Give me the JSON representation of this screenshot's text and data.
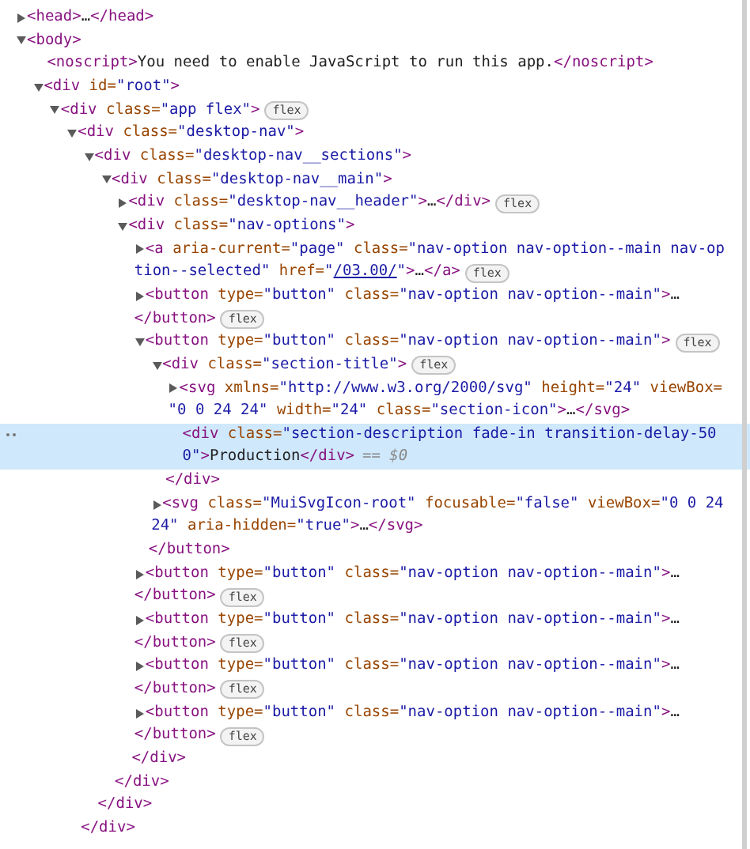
{
  "tree": [
    {
      "kind": "collapsed",
      "selected": false,
      "lines": [
        [
          {
            "kind": "tag",
            "text": "<head>"
          },
          {
            "kind": "text",
            "text": "…"
          },
          {
            "kind": "tag",
            "text": "</head>"
          }
        ]
      ]
    },
    {
      "kind": "expanded",
      "selected": false,
      "lines": [
        [
          {
            "kind": "tag",
            "text": "<body>"
          }
        ]
      ],
      "children": [
        {
          "kind": "leaf",
          "selected": false,
          "lines": [
            [
              {
                "kind": "tag",
                "text": "<noscript>"
              },
              {
                "kind": "text",
                "text": "You need to enable JavaScript to run this app."
              },
              {
                "kind": "tag",
                "text": "</noscript>"
              }
            ]
          ]
        },
        {
          "kind": "expanded",
          "selected": false,
          "lines": [
            [
              {
                "kind": "tag",
                "text": "<div"
              },
              {
                "kind": "attr",
                "text": " id="
              },
              {
                "kind": "value",
                "text": "\"root\""
              },
              {
                "kind": "tag",
                "text": ">"
              }
            ]
          ],
          "children": [
            {
              "kind": "expanded",
              "selected": false,
              "badge": "flex",
              "lines": [
                [
                  {
                    "kind": "tag",
                    "text": "<div"
                  },
                  {
                    "kind": "attr",
                    "text": " class="
                  },
                  {
                    "kind": "value",
                    "text": "\"app flex\""
                  },
                  {
                    "kind": "tag",
                    "text": ">"
                  }
                ]
              ],
              "children": [
                {
                  "kind": "expanded",
                  "selected": false,
                  "lines": [
                    [
                      {
                        "kind": "tag",
                        "text": "<div"
                      },
                      {
                        "kind": "attr",
                        "text": " class="
                      },
                      {
                        "kind": "value",
                        "text": "\"desktop-nav\""
                      },
                      {
                        "kind": "tag",
                        "text": ">"
                      }
                    ]
                  ],
                  "close": [
                    {
                      "kind": "tag",
                      "text": "</div>"
                    }
                  ],
                  "children": [
                    {
                      "kind": "expanded",
                      "selected": false,
                      "lines": [
                        [
                          {
                            "kind": "tag",
                            "text": "<div"
                          },
                          {
                            "kind": "attr",
                            "text": " class="
                          },
                          {
                            "kind": "value",
                            "text": "\"desktop-nav__sections\""
                          },
                          {
                            "kind": "tag",
                            "text": ">"
                          }
                        ]
                      ],
                      "close": [
                        {
                          "kind": "tag",
                          "text": "</div>"
                        }
                      ],
                      "children": [
                        {
                          "kind": "expanded",
                          "selected": false,
                          "lines": [
                            [
                              {
                                "kind": "tag",
                                "text": "<div"
                              },
                              {
                                "kind": "attr",
                                "text": " class="
                              },
                              {
                                "kind": "value",
                                "text": "\"desktop-nav__main\""
                              },
                              {
                                "kind": "tag",
                                "text": ">"
                              }
                            ]
                          ],
                          "close": [
                            {
                              "kind": "tag",
                              "text": "</div>"
                            }
                          ],
                          "children": [
                            {
                              "kind": "collapsed",
                              "selected": false,
                              "badge": "flex",
                              "lines": [
                                [
                                  {
                                    "kind": "tag",
                                    "text": "<div"
                                  },
                                  {
                                    "kind": "attr",
                                    "text": " class="
                                  },
                                  {
                                    "kind": "value",
                                    "text": "\"desktop-nav__header\""
                                  },
                                  {
                                    "kind": "tag",
                                    "text": ">"
                                  },
                                  {
                                    "kind": "text",
                                    "text": "…"
                                  },
                                  {
                                    "kind": "tag",
                                    "text": "</div>"
                                  }
                                ]
                              ]
                            },
                            {
                              "kind": "expanded",
                              "selected": false,
                              "lines": [
                                [
                                  {
                                    "kind": "tag",
                                    "text": "<div"
                                  },
                                  {
                                    "kind": "attr",
                                    "text": " class="
                                  },
                                  {
                                    "kind": "value",
                                    "text": "\"nav-options\""
                                  },
                                  {
                                    "kind": "tag",
                                    "text": ">"
                                  }
                                ]
                              ],
                              "close": [
                                {
                                  "kind": "tag",
                                  "text": "</div>"
                                }
                              ],
                              "children": [
                                {
                                  "kind": "collapsed",
                                  "selected": false,
                                  "badge": "flex",
                                  "lines": [
                                    [
                                      {
                                        "kind": "tag",
                                        "text": "<a"
                                      },
                                      {
                                        "kind": "attr",
                                        "text": " aria-current="
                                      },
                                      {
                                        "kind": "value",
                                        "text": "\"page\""
                                      },
                                      {
                                        "kind": "attr",
                                        "text": " class="
                                      },
                                      {
                                        "kind": "value",
                                        "text": "\"nav-option nav-option--main nav-op"
                                      }
                                    ],
                                    [
                                      {
                                        "kind": "value",
                                        "text": "tion--selected\""
                                      },
                                      {
                                        "kind": "attr",
                                        "text": " href="
                                      },
                                      {
                                        "kind": "value",
                                        "text": "\""
                                      },
                                      {
                                        "kind": "link",
                                        "text": "/03.00/"
                                      },
                                      {
                                        "kind": "value",
                                        "text": "\""
                                      },
                                      {
                                        "kind": "tag",
                                        "text": ">"
                                      },
                                      {
                                        "kind": "text",
                                        "text": "…"
                                      },
                                      {
                                        "kind": "tag",
                                        "text": "</a>"
                                      }
                                    ]
                                  ]
                                },
                                {
                                  "kind": "collapsed",
                                  "selected": false,
                                  "badge": "flex",
                                  "lines": [
                                    [
                                      {
                                        "kind": "tag",
                                        "text": "<button"
                                      },
                                      {
                                        "kind": "attr",
                                        "text": " type="
                                      },
                                      {
                                        "kind": "value",
                                        "text": "\"button\""
                                      },
                                      {
                                        "kind": "attr",
                                        "text": " class="
                                      },
                                      {
                                        "kind": "value",
                                        "text": "\"nav-option nav-option--main\""
                                      },
                                      {
                                        "kind": "tag",
                                        "text": ">"
                                      },
                                      {
                                        "kind": "text",
                                        "text": "…"
                                      }
                                    ],
                                    [
                                      {
                                        "kind": "tag",
                                        "text": "</button>"
                                      }
                                    ]
                                  ]
                                },
                                {
                                  "kind": "expanded",
                                  "selected": false,
                                  "badge": "flex",
                                  "lines": [
                                    [
                                      {
                                        "kind": "tag",
                                        "text": "<button"
                                      },
                                      {
                                        "kind": "attr",
                                        "text": " type="
                                      },
                                      {
                                        "kind": "value",
                                        "text": "\"button\""
                                      },
                                      {
                                        "kind": "attr",
                                        "text": " class="
                                      },
                                      {
                                        "kind": "value",
                                        "text": "\"nav-option nav-option--main\""
                                      },
                                      {
                                        "kind": "tag",
                                        "text": ">"
                                      }
                                    ]
                                  ],
                                  "close": [
                                    {
                                      "kind": "tag",
                                      "text": "</button>"
                                    }
                                  ],
                                  "children": [
                                    {
                                      "kind": "expanded",
                                      "selected": false,
                                      "badge": "flex",
                                      "lines": [
                                        [
                                          {
                                            "kind": "tag",
                                            "text": "<div"
                                          },
                                          {
                                            "kind": "attr",
                                            "text": " class="
                                          },
                                          {
                                            "kind": "value",
                                            "text": "\"section-title\""
                                          },
                                          {
                                            "kind": "tag",
                                            "text": ">"
                                          }
                                        ]
                                      ],
                                      "close": [
                                        {
                                          "kind": "tag",
                                          "text": "</div>"
                                        }
                                      ],
                                      "children": [
                                        {
                                          "kind": "collapsed",
                                          "selected": false,
                                          "lines": [
                                            [
                                              {
                                                "kind": "tag",
                                                "text": "<svg"
                                              },
                                              {
                                                "kind": "attr",
                                                "text": " xmlns="
                                              },
                                              {
                                                "kind": "value",
                                                "text": "\"http://www.w3.org/2000/svg\""
                                              },
                                              {
                                                "kind": "attr",
                                                "text": " height="
                                              },
                                              {
                                                "kind": "value",
                                                "text": "\"24\""
                                              },
                                              {
                                                "kind": "attr",
                                                "text": " viewBox="
                                              }
                                            ],
                                            [
                                              {
                                                "kind": "value",
                                                "text": "\"0 0 24 24\""
                                              },
                                              {
                                                "kind": "attr",
                                                "text": " width="
                                              },
                                              {
                                                "kind": "value",
                                                "text": "\"24\""
                                              },
                                              {
                                                "kind": "attr",
                                                "text": " class="
                                              },
                                              {
                                                "kind": "value",
                                                "text": "\"section-icon\""
                                              },
                                              {
                                                "kind": "tag",
                                                "text": ">"
                                              },
                                              {
                                                "kind": "text",
                                                "text": "…"
                                              },
                                              {
                                                "kind": "tag",
                                                "text": "</svg>"
                                              }
                                            ]
                                          ]
                                        },
                                        {
                                          "kind": "leaf",
                                          "selected": true,
                                          "suffix": "== $0",
                                          "lines": [
                                            [
                                              {
                                                "kind": "tag",
                                                "text": "<div"
                                              },
                                              {
                                                "kind": "attr",
                                                "text": " class="
                                              },
                                              {
                                                "kind": "value",
                                                "text": "\"section-description fade-in transition-delay-50"
                                              }
                                            ],
                                            [
                                              {
                                                "kind": "value",
                                                "text": "0\""
                                              },
                                              {
                                                "kind": "tag",
                                                "text": ">"
                                              },
                                              {
                                                "kind": "text",
                                                "text": "Production"
                                              },
                                              {
                                                "kind": "tag",
                                                "text": "</div>"
                                              }
                                            ]
                                          ]
                                        }
                                      ]
                                    },
                                    {
                                      "kind": "collapsed",
                                      "selected": false,
                                      "lines": [
                                        [
                                          {
                                            "kind": "tag",
                                            "text": "<svg"
                                          },
                                          {
                                            "kind": "attr",
                                            "text": " class="
                                          },
                                          {
                                            "kind": "value",
                                            "text": "\"MuiSvgIcon-root\""
                                          },
                                          {
                                            "kind": "attr",
                                            "text": " focusable="
                                          },
                                          {
                                            "kind": "value",
                                            "text": "\"false\""
                                          },
                                          {
                                            "kind": "attr",
                                            "text": " viewBox="
                                          },
                                          {
                                            "kind": "value",
                                            "text": "\"0 0 24"
                                          }
                                        ],
                                        [
                                          {
                                            "kind": "value",
                                            "text": "24\""
                                          },
                                          {
                                            "kind": "attr",
                                            "text": " aria-hidden="
                                          },
                                          {
                                            "kind": "value",
                                            "text": "\"true\""
                                          },
                                          {
                                            "kind": "tag",
                                            "text": ">"
                                          },
                                          {
                                            "kind": "text",
                                            "text": "…"
                                          },
                                          {
                                            "kind": "tag",
                                            "text": "</svg>"
                                          }
                                        ]
                                      ]
                                    }
                                  ]
                                },
                                {
                                  "kind": "collapsed",
                                  "selected": false,
                                  "badge": "flex",
                                  "lines": [
                                    [
                                      {
                                        "kind": "tag",
                                        "text": "<button"
                                      },
                                      {
                                        "kind": "attr",
                                        "text": " type="
                                      },
                                      {
                                        "kind": "value",
                                        "text": "\"button\""
                                      },
                                      {
                                        "kind": "attr",
                                        "text": " class="
                                      },
                                      {
                                        "kind": "value",
                                        "text": "\"nav-option nav-option--main\""
                                      },
                                      {
                                        "kind": "tag",
                                        "text": ">"
                                      },
                                      {
                                        "kind": "text",
                                        "text": "…"
                                      }
                                    ],
                                    [
                                      {
                                        "kind": "tag",
                                        "text": "</button>"
                                      }
                                    ]
                                  ]
                                },
                                {
                                  "kind": "collapsed",
                                  "selected": false,
                                  "badge": "flex",
                                  "lines": [
                                    [
                                      {
                                        "kind": "tag",
                                        "text": "<button"
                                      },
                                      {
                                        "kind": "attr",
                                        "text": " type="
                                      },
                                      {
                                        "kind": "value",
                                        "text": "\"button\""
                                      },
                                      {
                                        "kind": "attr",
                                        "text": " class="
                                      },
                                      {
                                        "kind": "value",
                                        "text": "\"nav-option nav-option--main\""
                                      },
                                      {
                                        "kind": "tag",
                                        "text": ">"
                                      },
                                      {
                                        "kind": "text",
                                        "text": "…"
                                      }
                                    ],
                                    [
                                      {
                                        "kind": "tag",
                                        "text": "</button>"
                                      }
                                    ]
                                  ]
                                },
                                {
                                  "kind": "collapsed",
                                  "selected": false,
                                  "badge": "flex",
                                  "lines": [
                                    [
                                      {
                                        "kind": "tag",
                                        "text": "<button"
                                      },
                                      {
                                        "kind": "attr",
                                        "text": " type="
                                      },
                                      {
                                        "kind": "value",
                                        "text": "\"button\""
                                      },
                                      {
                                        "kind": "attr",
                                        "text": " class="
                                      },
                                      {
                                        "kind": "value",
                                        "text": "\"nav-option nav-option--main\""
                                      },
                                      {
                                        "kind": "tag",
                                        "text": ">"
                                      },
                                      {
                                        "kind": "text",
                                        "text": "…"
                                      }
                                    ],
                                    [
                                      {
                                        "kind": "tag",
                                        "text": "</button>"
                                      }
                                    ]
                                  ]
                                },
                                {
                                  "kind": "collapsed",
                                  "selected": false,
                                  "badge": "flex",
                                  "lines": [
                                    [
                                      {
                                        "kind": "tag",
                                        "text": "<button"
                                      },
                                      {
                                        "kind": "attr",
                                        "text": " type="
                                      },
                                      {
                                        "kind": "value",
                                        "text": "\"button\""
                                      },
                                      {
                                        "kind": "attr",
                                        "text": " class="
                                      },
                                      {
                                        "kind": "value",
                                        "text": "\"nav-option nav-option--main\""
                                      },
                                      {
                                        "kind": "tag",
                                        "text": ">"
                                      },
                                      {
                                        "kind": "text",
                                        "text": "…"
                                      }
                                    ],
                                    [
                                      {
                                        "kind": "tag",
                                        "text": "</button>"
                                      }
                                    ]
                                  ]
                                }
                              ]
                            }
                          ]
                        }
                      ]
                    }
                  ]
                }
              ]
            }
          ]
        }
      ]
    }
  ]
}
